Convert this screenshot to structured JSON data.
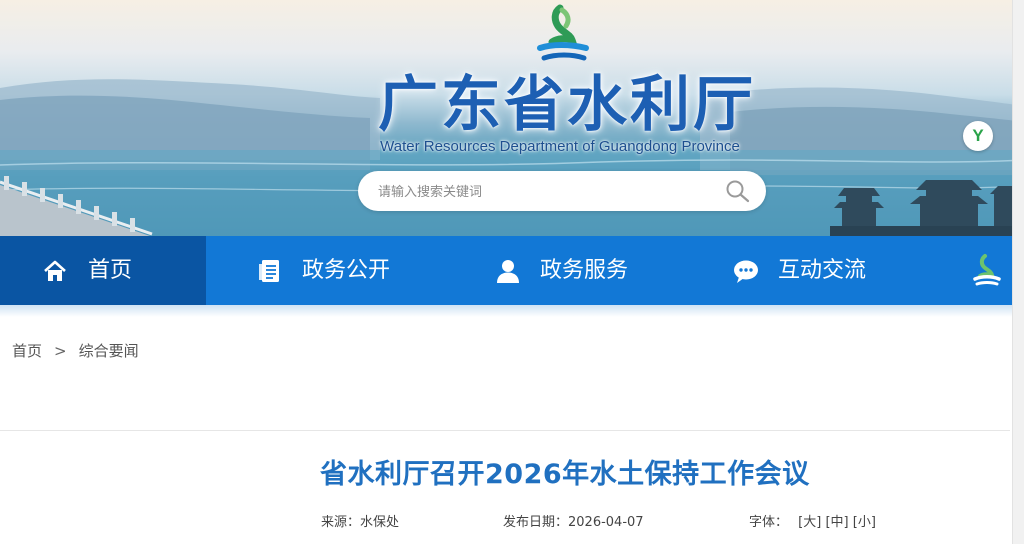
{
  "header": {
    "site_title": "广东省水利厅",
    "site_subtitle": "Water Resources Department of Guangdong Province",
    "emblem_icon": "guangdong-emblem-icon",
    "search": {
      "placeholder": "请输入搜索关键词",
      "value": ""
    },
    "accessibility_label": "Y"
  },
  "nav": {
    "items": [
      {
        "label": "首页",
        "icon": "home-icon",
        "active": true
      },
      {
        "label": "政务公开",
        "icon": "document-icon",
        "active": false
      },
      {
        "label": "政务服务",
        "icon": "user-icon",
        "active": false
      },
      {
        "label": "互动交流",
        "icon": "chat-icon",
        "active": false
      }
    ]
  },
  "breadcrumb": {
    "home": "首页",
    "separator": ">",
    "current": "综合要闻"
  },
  "article": {
    "title": "省水利厅召开2026年水土保持工作会议",
    "source_label": "来源：",
    "source_value": "水保处",
    "date_label": "发布日期：",
    "date_value": "2026-04-07",
    "font_label": "字体：",
    "font_sizes": [
      "[大]",
      "[中]",
      "[小]"
    ]
  },
  "colors": {
    "nav_bg": "#1278d6",
    "nav_active_bg": "#0a55a3",
    "title_blue": "#2070c0",
    "site_title_blue": "#1d5fb3"
  }
}
